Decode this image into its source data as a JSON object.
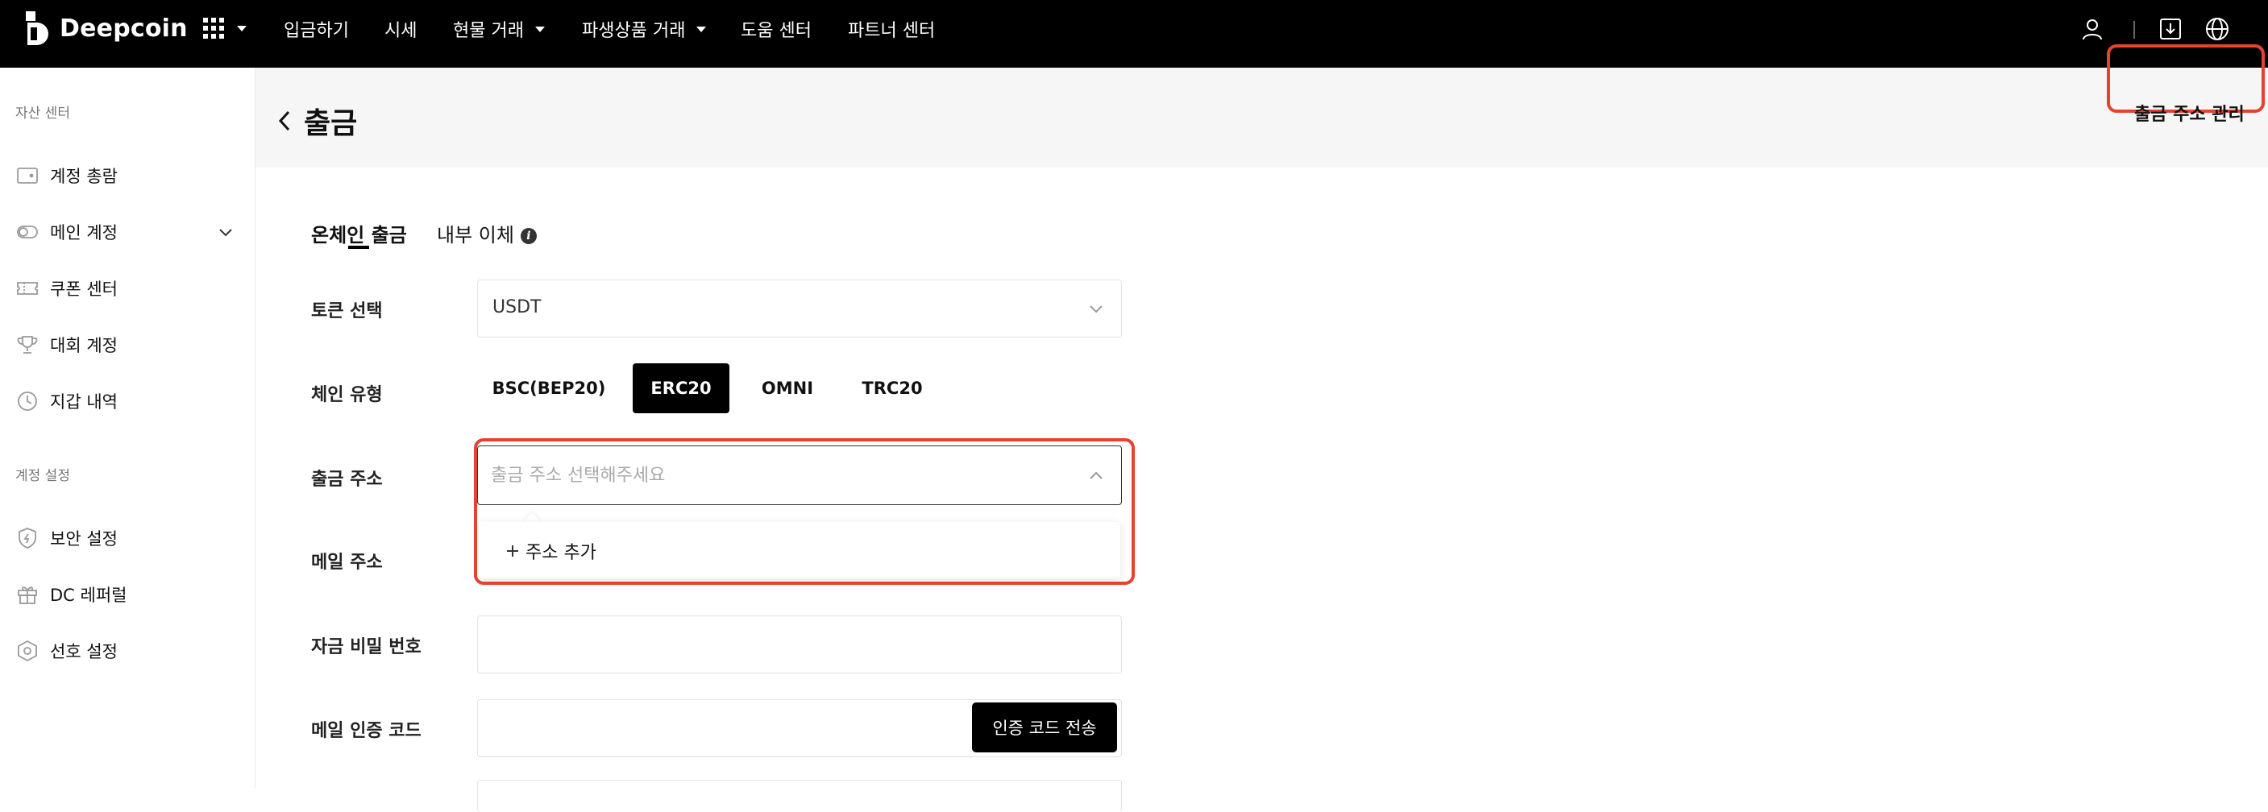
{
  "brand": {
    "name": "Deepcoin"
  },
  "nav": {
    "items": [
      {
        "label": "입금하기"
      },
      {
        "label": "시세"
      },
      {
        "label": "현물 거래"
      },
      {
        "label": "파생상품 거래"
      },
      {
        "label": "도움 센터"
      },
      {
        "label": "파트너 센터"
      }
    ],
    "right_icons": [
      "user-icon",
      "download-icon",
      "globe-icon"
    ]
  },
  "sidebar": {
    "section1": "자산 센터",
    "items1": [
      {
        "label": "계정 총람",
        "icon": "wallet-icon"
      },
      {
        "label": "메인 계정",
        "icon": "toggle-icon"
      },
      {
        "label": "쿠폰 센터",
        "icon": "ticket-icon"
      },
      {
        "label": "대회 계정",
        "icon": "trophy-icon"
      },
      {
        "label": "지갑 내역",
        "icon": "clock-icon"
      }
    ],
    "section2": "계정 설정",
    "items2": [
      {
        "label": "보안 설정",
        "icon": "shield-icon"
      },
      {
        "label": "DC 레퍼럴",
        "icon": "gift-icon"
      },
      {
        "label": "선호 설정",
        "icon": "hexagon-settings-icon"
      }
    ]
  },
  "header": {
    "title": "출금",
    "address_manage": "출금 주소 관리"
  },
  "tabs": {
    "onchain": "온체인 출금",
    "internal": "내부 이체"
  },
  "form": {
    "token_label": "토큰 선택",
    "token_value": "USDT",
    "chain_label": "체인 유형",
    "chains": [
      "BSC(BEP20)",
      "ERC20",
      "OMNI",
      "TRC20"
    ],
    "selected_chain": "ERC20",
    "address_label": "출금 주소",
    "address_placeholder": "출금 주소 선택해주세요",
    "add_address": "주소 추가",
    "email_label": "메일 주소",
    "fund_password_label": "자금 비밀 번호",
    "email_code_label": "메일 인증 코드",
    "send_code": "인증 코드 전송"
  },
  "colors": {
    "highlight": "#e5432d",
    "topbar": "#000000",
    "header_bg": "#f6f6f6"
  }
}
